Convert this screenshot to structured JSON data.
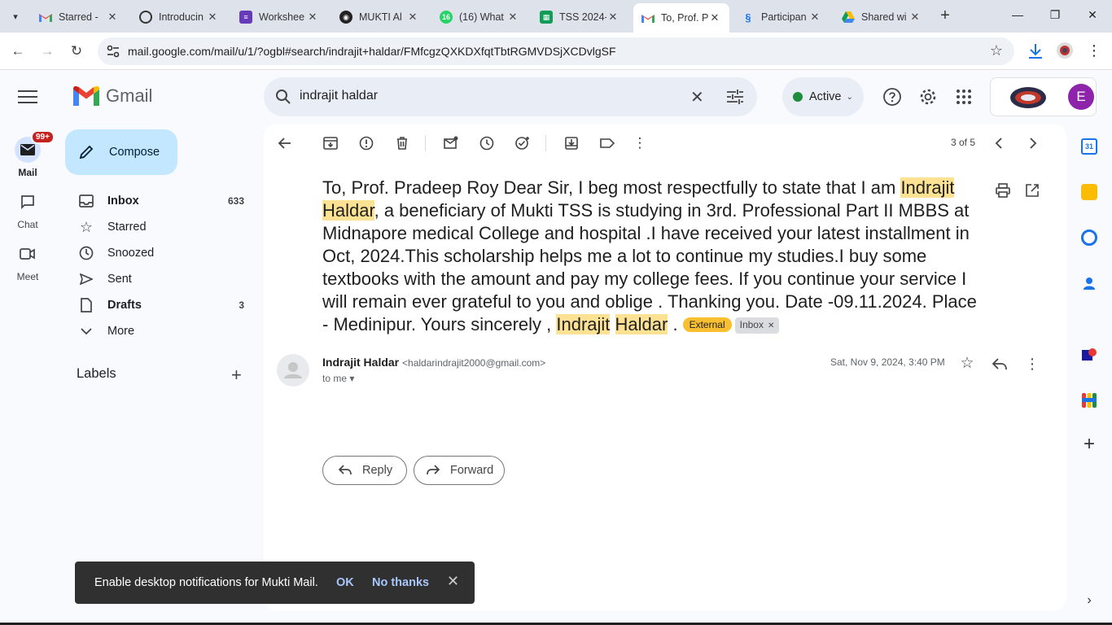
{
  "browser": {
    "tabs": [
      {
        "title": "Starred - ",
        "active": false
      },
      {
        "title": "Introducin",
        "active": false
      },
      {
        "title": "Workshee",
        "active": false
      },
      {
        "title": "MUKTI Al",
        "active": false
      },
      {
        "title": "(16) What",
        "active": false
      },
      {
        "title": "TSS 2024-",
        "active": false
      },
      {
        "title": "To, Prof. P",
        "active": true
      },
      {
        "title": "Participan",
        "active": false
      },
      {
        "title": "Shared wi",
        "active": false
      }
    ],
    "tab_badge": "16",
    "url": "mail.google.com/mail/u/1/?ogbl#search/indrajit+haldar/FMfcgzQXKDXfqtTbtRGMVDSjXCDvlgSF"
  },
  "rail": {
    "mail_label": "Mail",
    "mail_badge": "99+",
    "chat_label": "Chat",
    "meet_label": "Meet"
  },
  "gmail": {
    "logo_text": "Gmail",
    "compose_label": "Compose",
    "nav": [
      {
        "label": "Inbox",
        "count": "633",
        "bold": true
      },
      {
        "label": "Starred",
        "count": "",
        "bold": false
      },
      {
        "label": "Snoozed",
        "count": "",
        "bold": false
      },
      {
        "label": "Sent",
        "count": "",
        "bold": false
      },
      {
        "label": "Drafts",
        "count": "3",
        "bold": true
      },
      {
        "label": "More",
        "count": "",
        "bold": false
      }
    ],
    "labels_header": "Labels"
  },
  "search": {
    "query": "indrajit haldar"
  },
  "status": {
    "label": "Active"
  },
  "account": {
    "avatar_letter": "E"
  },
  "message": {
    "pager": "3 of 5",
    "subject_parts": {
      "p1": "To, Prof. Pradeep Roy Dear Sir, I beg most respectfully to state that I am ",
      "h1": "Indrajit Haldar",
      "p2": ", a beneficiary of Mukti TSS is studying in 3rd. Professional Part II MBBS at Midnapore medical College and hospital .I have received your latest installment in Oct, 2024.This scholarship helps me a lot to continue my studies.I buy some textbooks with the amount and pay my college fees. If you continue your service I will remain ever grateful to you and oblige . Thanking you. Date -09.11.2024. Place - Medinipur. Yours sincerely , ",
      "h2a": "Indrajit",
      "h2b": "Haldar",
      "p3": " ."
    },
    "chip_external": "External",
    "chip_inbox": "Inbox",
    "sender_name": "Indrajit Haldar",
    "sender_email": "<haldarindrajit2000@gmail.com>",
    "to_line": "to me",
    "date": "Sat, Nov 9, 2024, 3:40 PM",
    "reply_label": "Reply",
    "forward_label": "Forward"
  },
  "toast": {
    "message": "Enable desktop notifications for Mukti Mail.",
    "ok": "OK",
    "no_thanks": "No thanks"
  },
  "colors": {
    "compose_bg": "#c2e7ff",
    "highlight": "#fde293",
    "external_chip": "#f8bf31",
    "active_dot": "#1e8e3e",
    "avatar_bg": "#8e24aa"
  }
}
